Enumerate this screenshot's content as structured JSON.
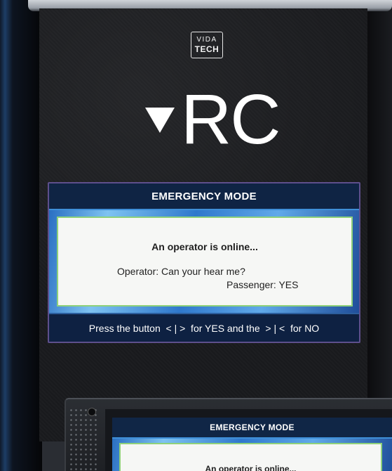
{
  "logo": {
    "line1": "VIDA",
    "line2": "TECH"
  },
  "direction": {
    "icon": "triangle-down-icon",
    "label": "RC"
  },
  "emergency_panel": {
    "title": "EMERGENCY MODE",
    "status": "An operator is online...",
    "operator_line": "Operator: Can your hear me?",
    "passenger_line": "Passenger: YES",
    "instruction": "Press the button  < | >  for YES and the  > | <  for NO"
  },
  "second_device": {
    "title": "EMERGENCY MODE",
    "status": "An operator is online..."
  },
  "colors": {
    "header_bg": "#0f2444",
    "frame_accent": "#3f8fd8",
    "message_border": "#8fd17a",
    "panel_bg": "#1b1c1f"
  }
}
